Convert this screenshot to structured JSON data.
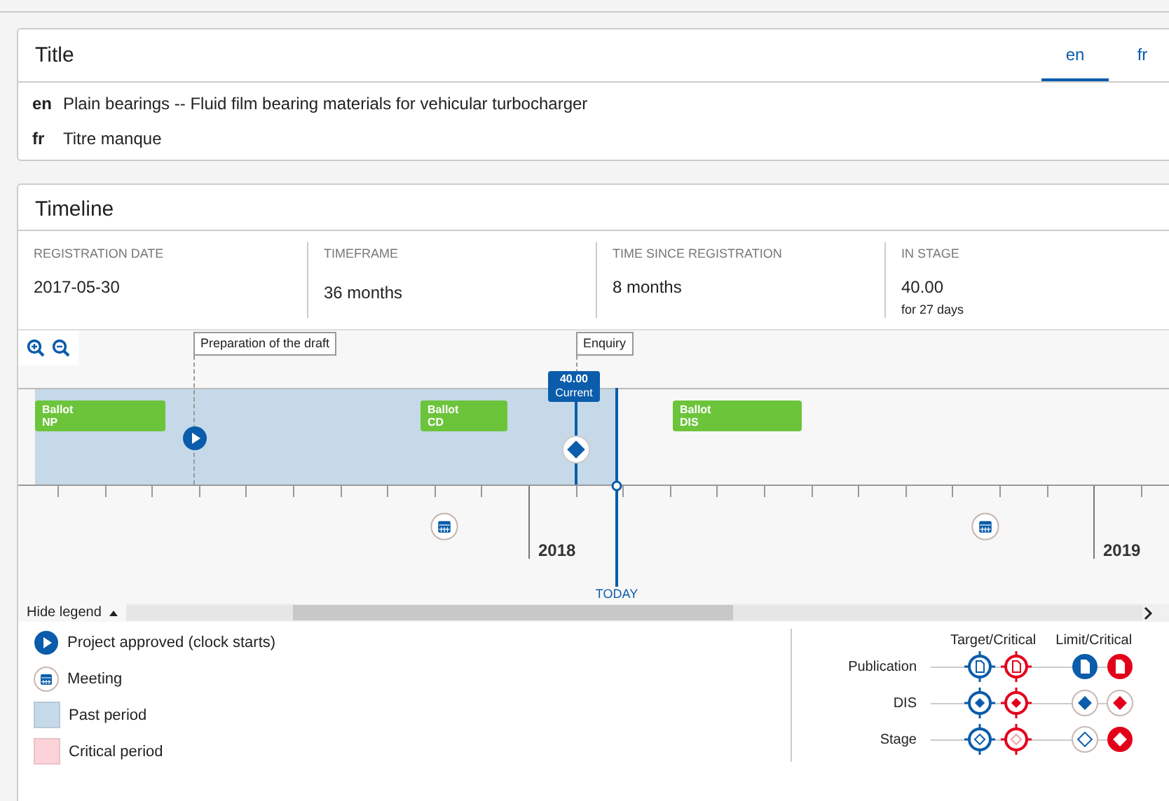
{
  "title_panel": {
    "heading": "Title",
    "tabs": [
      {
        "label": "en",
        "selected": true
      },
      {
        "label": "fr",
        "selected": false
      }
    ],
    "rows": [
      {
        "lang": "en",
        "text": "Plain bearings -- Fluid film bearing materials for vehicular turbocharger"
      },
      {
        "lang": "fr",
        "text": "Titre manque"
      }
    ]
  },
  "timeline": {
    "heading": "Timeline",
    "stats": [
      {
        "label": "REGISTRATION DATE",
        "value": "2017-05-30"
      },
      {
        "label": "TIMEFRAME",
        "value": "36 months"
      },
      {
        "label": "TIME SINCE REGISTRATION",
        "value": "8 months"
      },
      {
        "label": "IN STAGE",
        "value": "40.00",
        "note": "for 27 days"
      }
    ],
    "phases": [
      {
        "label": "Preparation of the draft"
      },
      {
        "label": "Enquiry"
      }
    ],
    "ballots": [
      {
        "title": "Ballot",
        "code": "NP"
      },
      {
        "title": "Ballot",
        "code": "CD"
      },
      {
        "title": "Ballot",
        "code": "DIS"
      }
    ],
    "current": {
      "value": "40.00",
      "label": "Current"
    },
    "years": [
      "2018",
      "2019"
    ],
    "today": "TODAY",
    "legend_toggle": {
      "label": "Hide legend",
      "expanded": true
    },
    "legend": [
      {
        "kind": "approved",
        "label": "Project approved (clock starts)"
      },
      {
        "kind": "meeting",
        "label": "Meeting"
      },
      {
        "kind": "past",
        "label": "Past period"
      },
      {
        "kind": "critical",
        "label": "Critical period"
      }
    ],
    "markers": {
      "columns": [
        "Target/Critical",
        "Limit/Critical"
      ],
      "rows": [
        {
          "kind": "publication",
          "label": "Publication"
        },
        {
          "kind": "dis",
          "label": "DIS"
        },
        {
          "kind": "stage",
          "label": "Stage"
        }
      ]
    }
  }
}
